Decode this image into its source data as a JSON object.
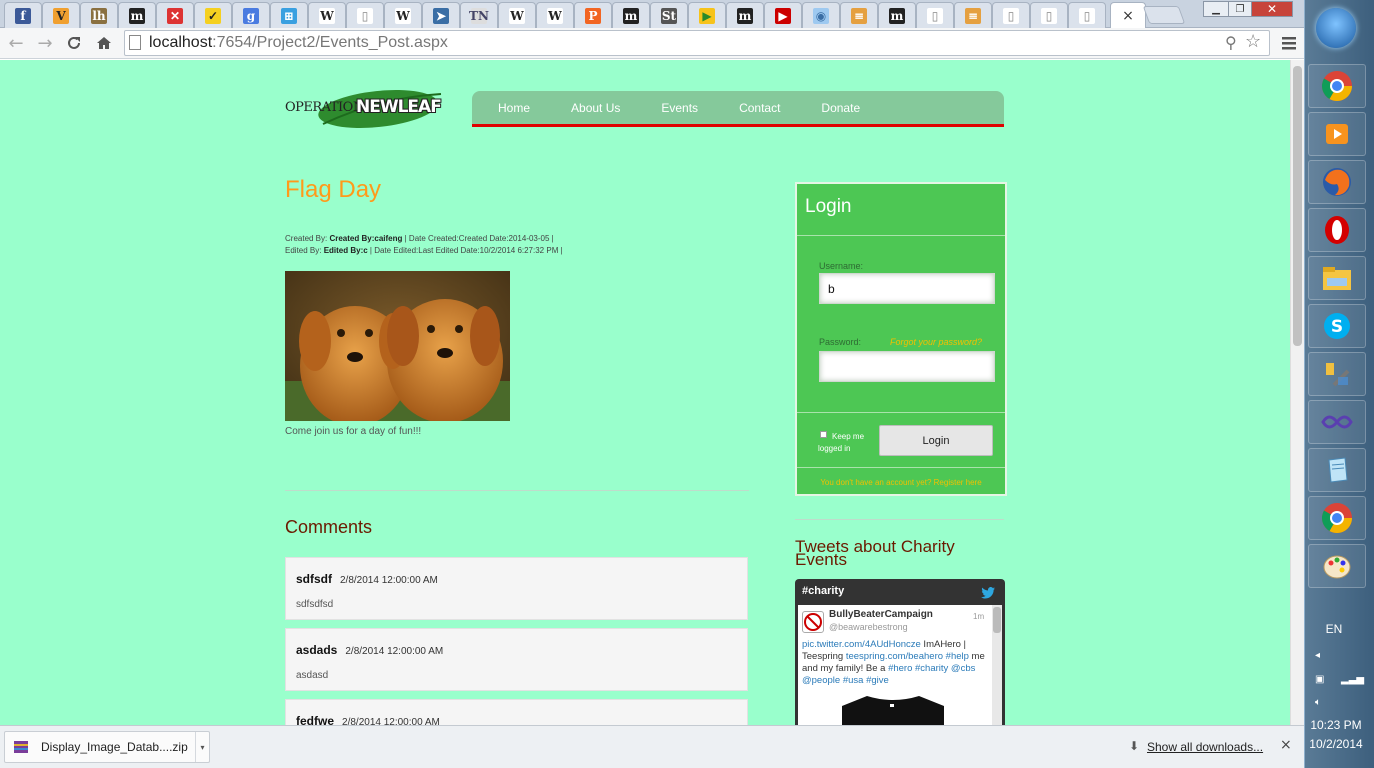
{
  "browser": {
    "url_host": "localhost",
    "url_path": ":7654/Project2/Events_Post.aspx",
    "tab_close": "×"
  },
  "site": {
    "logo_text_1": "OPERATION",
    "logo_text_2": "NEWLEAF",
    "nav": [
      "Home",
      "About Us",
      "Events",
      "Contact",
      "Donate"
    ]
  },
  "post": {
    "title": "Flag Day",
    "meta1_prefix": "Created By: ",
    "meta1_by": "Created By:caifeng",
    "meta1_suffix": " | Date Created:Created Date:2014-03-05 |",
    "meta2_prefix": "Edited By: ",
    "meta2_by": "Edited By:c",
    "meta2_suffix": " | Date Edited:Last Edited Date:10/2/2014 6:27:32 PM |",
    "caption": "Come join us for a day of fun!!!"
  },
  "comments": {
    "heading": "Comments",
    "items": [
      {
        "name": "sdfsdf",
        "date": "2/8/2014 12:00:00 AM",
        "text": "sdfsdfsd"
      },
      {
        "name": "asdads",
        "date": "2/8/2014 12:00:00 AM",
        "text": "asdasd"
      },
      {
        "name": "fedfwe",
        "date": "2/8/2014 12:00:00 AM",
        "text": ""
      }
    ]
  },
  "login": {
    "title": "Login",
    "username_label": "Username:",
    "username_value": "b",
    "password_label": "Password:",
    "forgot": "Forgot your password?",
    "keep_logged_in": "Keep me logged in",
    "button": "Login",
    "register": "You don't have an account yet? Register here"
  },
  "tweets": {
    "heading": "Tweets about Charity Events",
    "hashtag": "#charity",
    "user": "BullyBeaterCampaign",
    "handle": "@beawarebestrong",
    "time": "1m",
    "text_parts": [
      {
        "t": "pic.twitter.com/4AUdHoncze",
        "link": true
      },
      {
        "t": " ImAHero | Teespring ",
        "link": false
      },
      {
        "t": "teespring.com/beahero",
        "link": true
      },
      {
        "t": "  ",
        "link": false
      },
      {
        "t": "#help",
        "link": true
      },
      {
        "t": " me and my family! Be a ",
        "link": false
      },
      {
        "t": "#hero",
        "link": true
      },
      {
        "t": " ",
        "link": false
      },
      {
        "t": "#charity",
        "link": true
      },
      {
        "t": "  ",
        "link": false
      },
      {
        "t": "@cbs",
        "link": true
      },
      {
        "t": " ",
        "link": false
      },
      {
        "t": "@people",
        "link": true
      },
      {
        "t": " ",
        "link": false
      },
      {
        "t": "#usa",
        "link": true
      },
      {
        "t": " ",
        "link": false
      },
      {
        "t": "#give",
        "link": true
      }
    ]
  },
  "downloads": {
    "file": "Display_Image_Datab....zip",
    "show_all": "Show all downloads...",
    "close": "×"
  },
  "taskbar": {
    "lang": "EN",
    "time": "10:23 PM",
    "date": "10/2/2014"
  }
}
